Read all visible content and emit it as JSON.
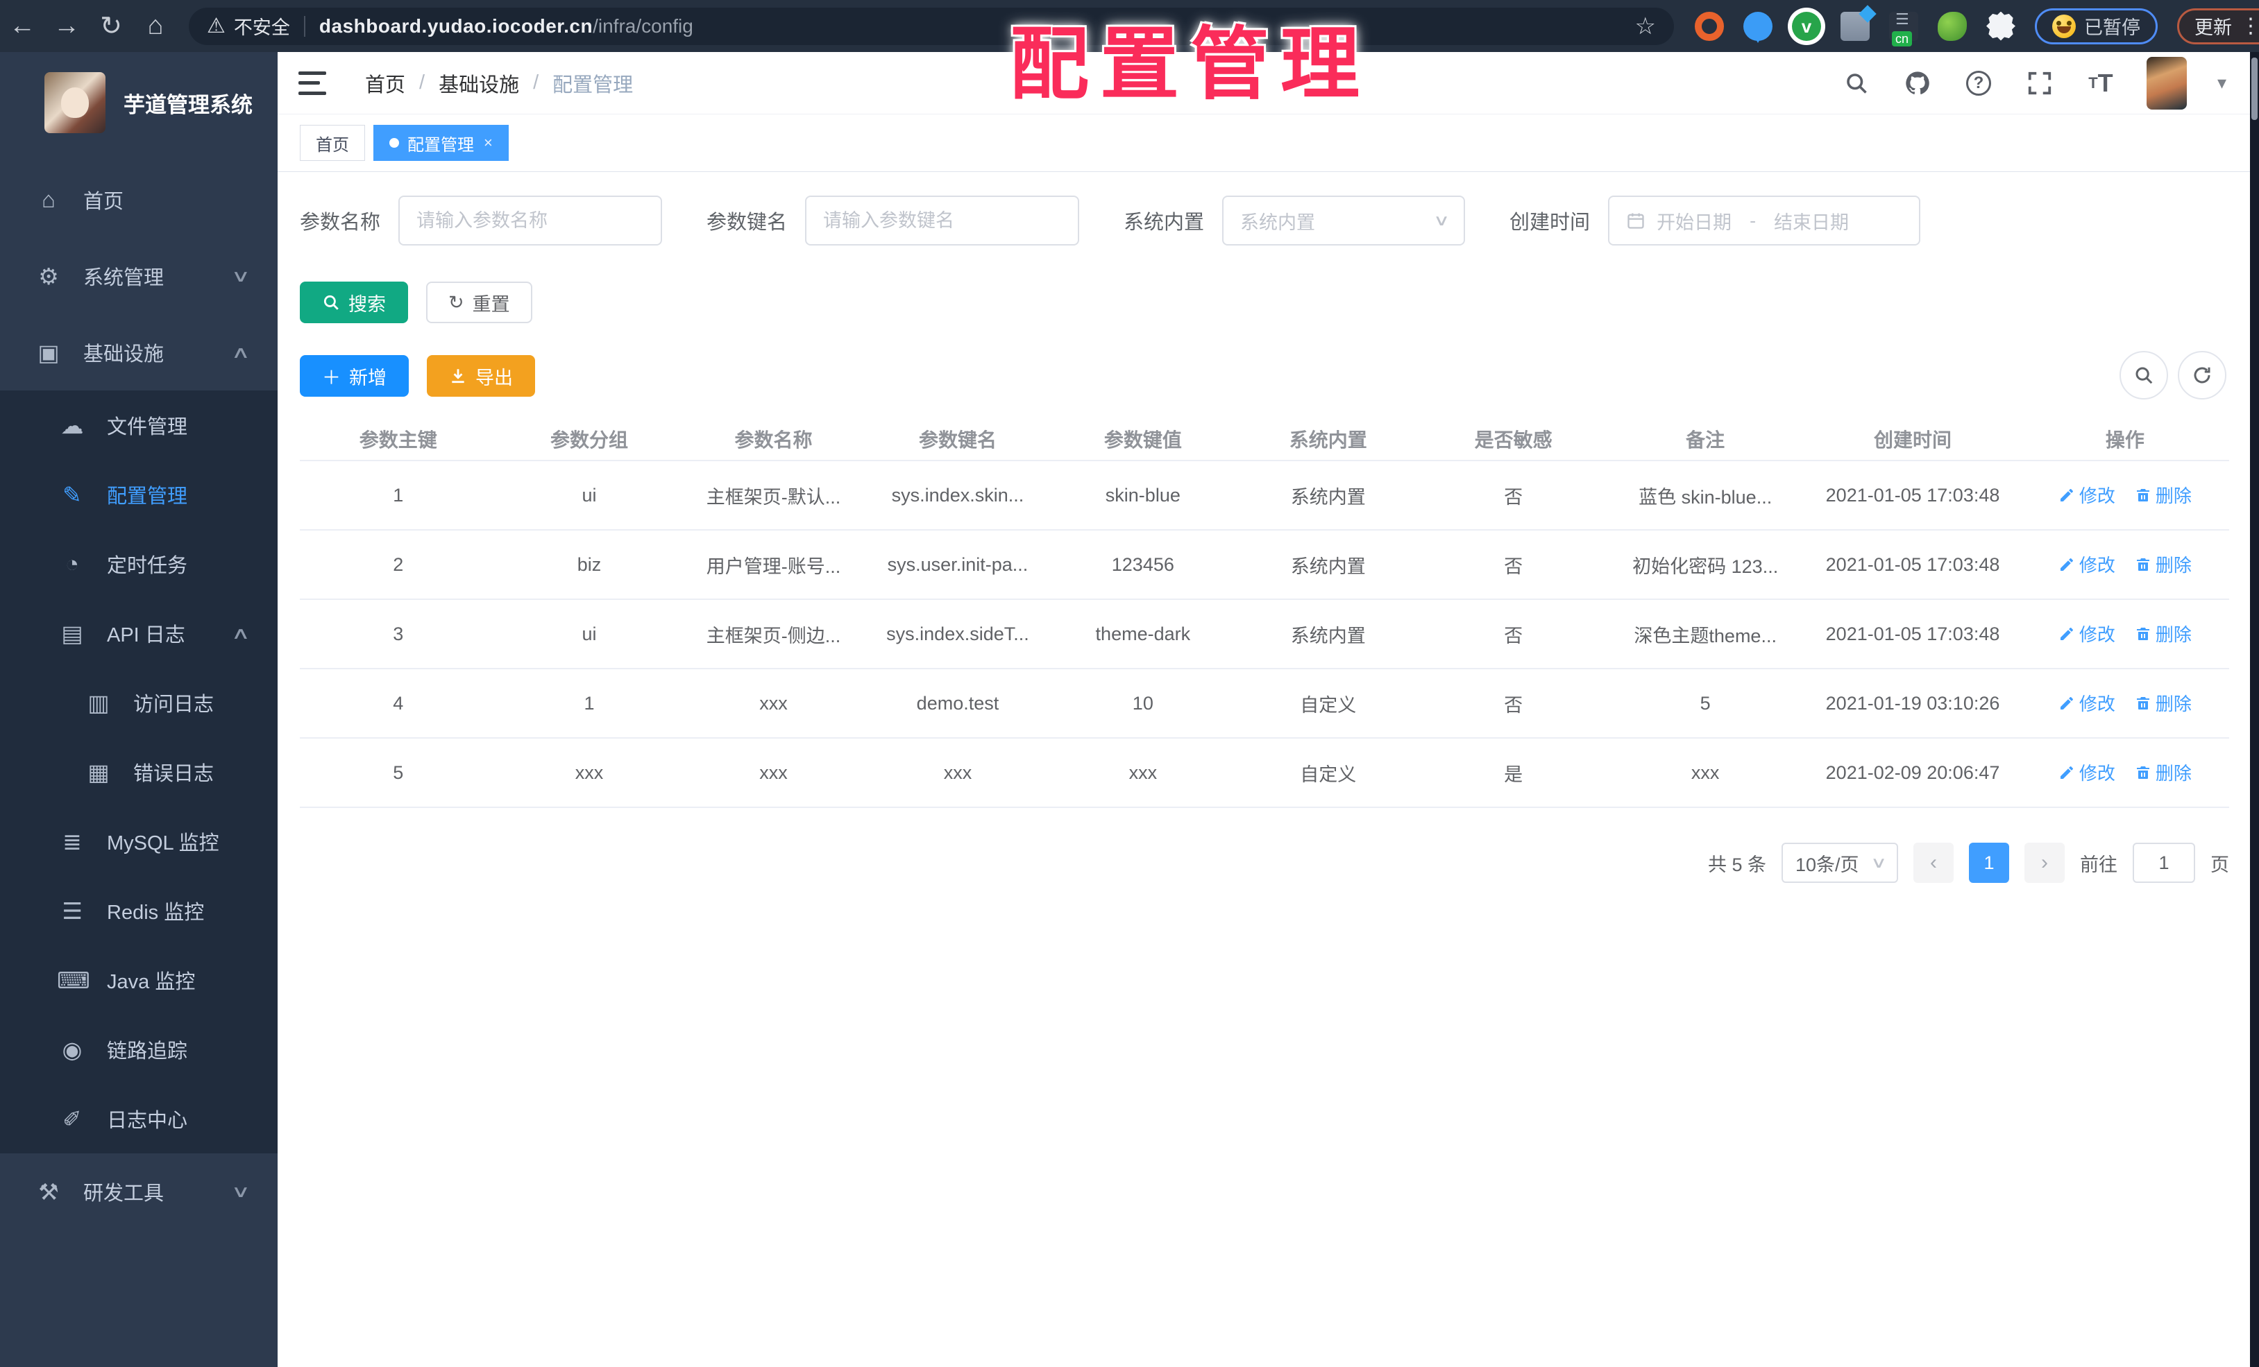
{
  "overlay_title": "配置管理",
  "browser": {
    "security_label": "不安全",
    "url_host": "dashboard.yudao.iocoder.cn",
    "url_path": "/infra/config",
    "paused_badge": "已暂停",
    "update_label": "更新"
  },
  "sidebar": {
    "app_title": "芋道管理系统",
    "items": [
      {
        "id": "home",
        "label": "首页",
        "icon": "home-icon",
        "level": 0
      },
      {
        "id": "system",
        "label": "系统管理",
        "icon": "gear-icon",
        "level": 0,
        "chevron": "down"
      },
      {
        "id": "infra",
        "label": "基础设施",
        "icon": "monitor-icon",
        "level": 0,
        "chevron": "up"
      },
      {
        "id": "file",
        "label": "文件管理",
        "icon": "cloud-icon",
        "level": 1
      },
      {
        "id": "config",
        "label": "配置管理",
        "icon": "edit-icon",
        "level": 1,
        "active": true
      },
      {
        "id": "job",
        "label": "定时任务",
        "icon": "timer-icon",
        "level": 1
      },
      {
        "id": "api-log",
        "label": "API 日志",
        "icon": "api-log-icon",
        "level": 1,
        "chevron": "up"
      },
      {
        "id": "access-log",
        "label": "访问日志",
        "icon": "access-log-icon",
        "level": 2
      },
      {
        "id": "error-log",
        "label": "错误日志",
        "icon": "error-log-icon",
        "level": 2
      },
      {
        "id": "mysql",
        "label": "MySQL 监控",
        "icon": "mysql-icon",
        "level": 1
      },
      {
        "id": "redis",
        "label": "Redis 监控",
        "icon": "redis-icon",
        "level": 1
      },
      {
        "id": "java",
        "label": "Java 监控",
        "icon": "java-icon",
        "level": 1
      },
      {
        "id": "trace",
        "label": "链路追踪",
        "icon": "eye-icon",
        "level": 1
      },
      {
        "id": "log-center",
        "label": "日志中心",
        "icon": "log-center-icon",
        "level": 1
      },
      {
        "id": "dev-tools",
        "label": "研发工具",
        "icon": "toolbox-icon",
        "level": 0,
        "chevron": "down"
      }
    ]
  },
  "header": {
    "breadcrumb": [
      "首页",
      "基础设施",
      "配置管理"
    ]
  },
  "tabs": [
    {
      "label": "首页",
      "active": false
    },
    {
      "label": "配置管理",
      "active": true
    }
  ],
  "filters": {
    "name": {
      "label": "参数名称",
      "placeholder": "请输入参数名称"
    },
    "key": {
      "label": "参数键名",
      "placeholder": "请输入参数键名"
    },
    "builtin": {
      "label": "系统内置",
      "placeholder": "系统内置"
    },
    "date": {
      "label": "创建时间",
      "start_placeholder": "开始日期",
      "separator": "-",
      "end_placeholder": "结束日期"
    }
  },
  "actions": {
    "search": "搜索",
    "reset": "重置",
    "add": "新增",
    "export": "导出"
  },
  "table": {
    "columns": [
      "参数主键",
      "参数分组",
      "参数名称",
      "参数键名",
      "参数键值",
      "系统内置",
      "是否敏感",
      "备注",
      "创建时间",
      "操作"
    ],
    "rows": [
      [
        "1",
        "ui",
        "主框架页-默认...",
        "sys.index.skin...",
        "skin-blue",
        "系统内置",
        "否",
        "蓝色 skin-blue...",
        "2021-01-05 17:03:48"
      ],
      [
        "2",
        "biz",
        "用户管理-账号...",
        "sys.user.init-pa...",
        "123456",
        "系统内置",
        "否",
        "初始化密码 123...",
        "2021-01-05 17:03:48"
      ],
      [
        "3",
        "ui",
        "主框架页-侧边...",
        "sys.index.sideT...",
        "theme-dark",
        "系统内置",
        "否",
        "深色主题theme...",
        "2021-01-05 17:03:48"
      ],
      [
        "4",
        "1",
        "xxx",
        "demo.test",
        "10",
        "自定义",
        "否",
        "5",
        "2021-01-19 03:10:26"
      ],
      [
        "5",
        "xxx",
        "xxx",
        "xxx",
        "xxx",
        "自定义",
        "是",
        "xxx",
        "2021-02-09 20:06:47"
      ]
    ],
    "edit_label": "修改",
    "delete_label": "删除"
  },
  "pagination": {
    "total_text": "共 5 条",
    "page_size": "10条/页",
    "prev": "‹",
    "current_page": "1",
    "next": "›",
    "goto_label": "前往",
    "goto_value": "1",
    "page_unit": "页"
  },
  "colors": {
    "accent": "#409EFF",
    "search_btn": "#11A983",
    "add_btn": "#1890FF",
    "export_btn": "#F3A11F",
    "overlay": "#FA2C5A",
    "sidebar_bg": "#2D3A4E",
    "submenu_bg": "#202C3D",
    "sidebar_text": "#C4CEDE"
  }
}
